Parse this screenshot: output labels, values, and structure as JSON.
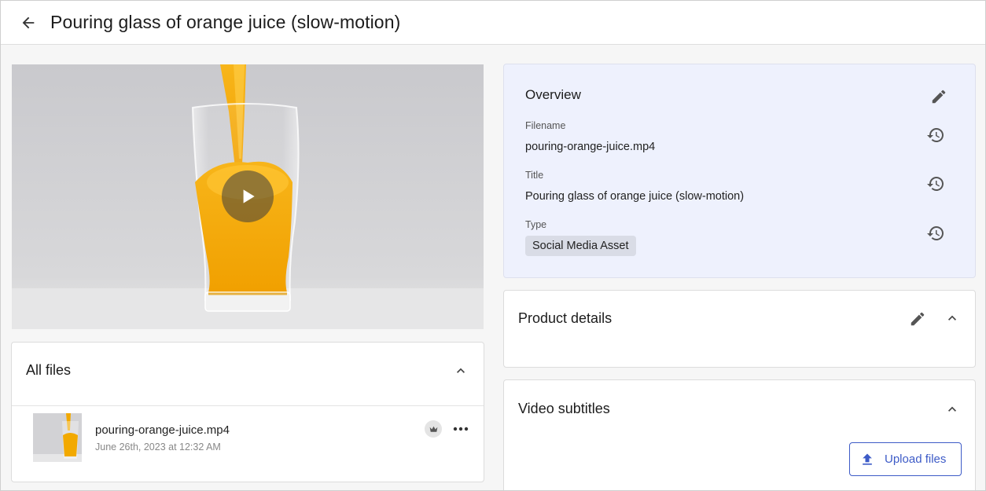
{
  "header": {
    "title": "Pouring glass of orange juice (slow-motion)",
    "back_icon": "arrow-left-icon"
  },
  "media": {
    "play_icon": "play-icon"
  },
  "all_files": {
    "title": "All files",
    "files": [
      {
        "name": "pouring-orange-juice.mp4",
        "date": "June 26th, 2023 at 12:32 AM"
      }
    ]
  },
  "overview": {
    "title": "Overview",
    "fields": [
      {
        "label": "Filename",
        "value": "pouring-orange-juice.mp4"
      },
      {
        "label": "Title",
        "value": "Pouring glass of orange juice (slow-motion)"
      },
      {
        "label": "Type",
        "value": "Social Media Asset"
      }
    ]
  },
  "product_details": {
    "title": "Product details"
  },
  "video_subtitles": {
    "title": "Video subtitles",
    "upload_label": "Upload files"
  },
  "colors": {
    "accent": "#3d5bc7",
    "overview_bg": "#eef1fd",
    "chip_bg": "#d9dce6",
    "juice": "#f2a900"
  }
}
